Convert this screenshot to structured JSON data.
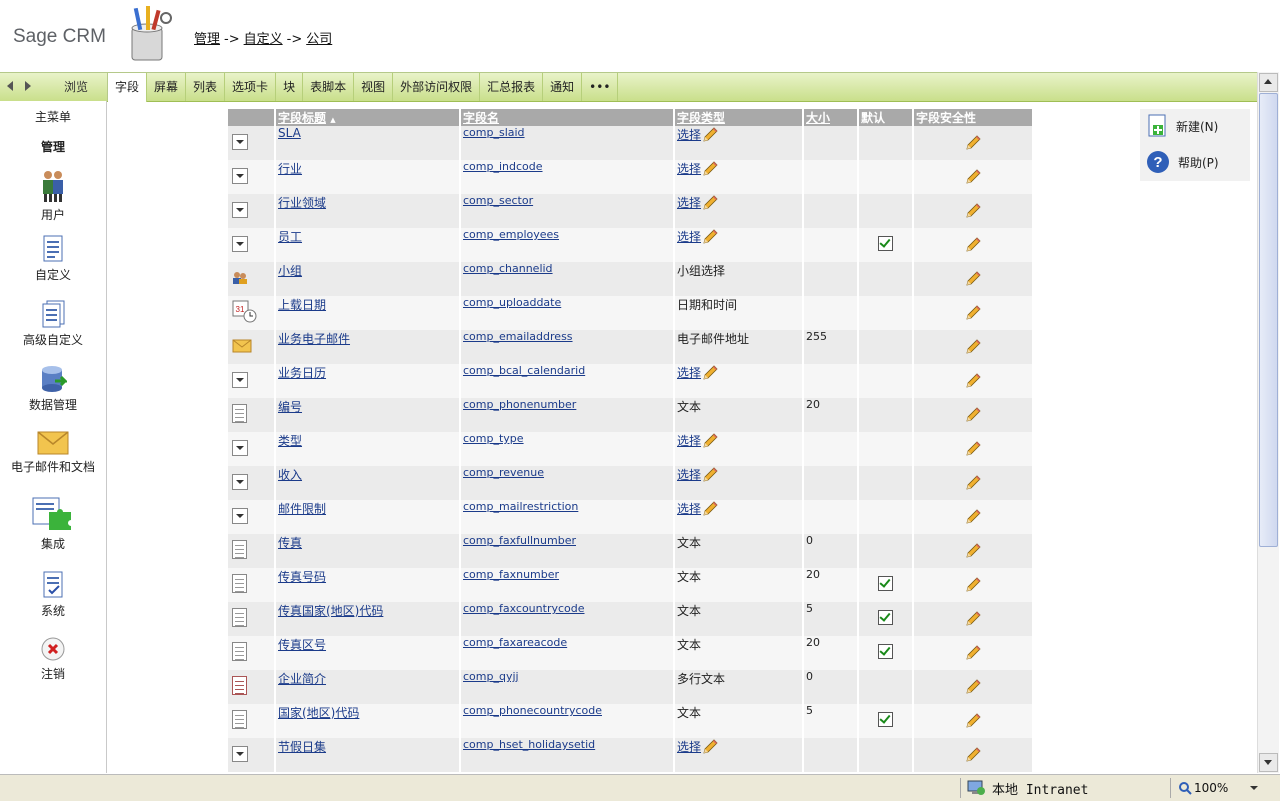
{
  "header": {
    "logo": "Sage CRM",
    "breadcrumb": [
      "管理",
      "自定义",
      "公司"
    ],
    "sep": "->"
  },
  "tabbar": {
    "browse": "浏览",
    "tabs": [
      "字段",
      "屏幕",
      "列表",
      "选项卡",
      "块",
      "表脚本",
      "视图",
      "外部访问权限",
      "汇总报表",
      "通知",
      "•••"
    ],
    "active": 0
  },
  "leftnav": {
    "main_menu": "主菜单",
    "admin": "管理",
    "items": [
      {
        "label": "用户",
        "icon": "users-icon"
      },
      {
        "label": "自定义",
        "icon": "document-icon"
      },
      {
        "label": "高级自定义",
        "icon": "documents-icon"
      },
      {
        "label": "数据管理",
        "icon": "database-icon"
      },
      {
        "label": "电子邮件和文档",
        "icon": "envelope-icon"
      },
      {
        "label": "集成",
        "icon": "puzzle-icon"
      },
      {
        "label": "系统",
        "icon": "checklist-icon"
      },
      {
        "label": "注销",
        "icon": "logout-icon"
      }
    ]
  },
  "actions": {
    "new": "新建(N)",
    "help": "帮助(P)"
  },
  "grid": {
    "columns": [
      "字段标题",
      "字段名",
      "字段类型",
      "大小",
      "默认",
      "字段安全性"
    ],
    "sort_indicator": "▲",
    "rows": [
      {
        "icon": "dropdown",
        "caption": "SLA",
        "name": "comp_slaid",
        "type": "选择",
        "type_link": true,
        "size": "",
        "default": false
      },
      {
        "icon": "dropdown",
        "caption": "行业",
        "name": "comp_indcode",
        "type": "选择",
        "type_link": true,
        "size": "",
        "default": false
      },
      {
        "icon": "dropdown",
        "caption": "行业领域",
        "name": "comp_sector",
        "type": "选择",
        "type_link": true,
        "size": "",
        "default": false
      },
      {
        "icon": "dropdown",
        "caption": "员工",
        "name": "comp_employees",
        "type": "选择",
        "type_link": true,
        "size": "",
        "default": true
      },
      {
        "icon": "team",
        "caption": "小组",
        "name": "comp_channelid",
        "type": "小组选择",
        "type_link": false,
        "size": "",
        "default": false
      },
      {
        "icon": "calendar",
        "caption": "上载日期",
        "name": "comp_uploaddate",
        "type": "日期和时间",
        "type_link": false,
        "size": "",
        "default": false
      },
      {
        "icon": "email",
        "caption": "业务电子邮件",
        "name": "comp_emailaddress",
        "type": "电子邮件地址",
        "type_link": false,
        "size": "255",
        "default": false
      },
      {
        "icon": "dropdown",
        "caption": "业务日历",
        "name": "comp_bcal_calendarid",
        "type": "选择",
        "type_link": true,
        "size": "",
        "default": false
      },
      {
        "icon": "text",
        "caption": "编号",
        "name": "comp_phonenumber",
        "type": "文本",
        "type_link": false,
        "size": "20",
        "default": false
      },
      {
        "icon": "dropdown",
        "caption": "类型",
        "name": "comp_type",
        "type": "选择",
        "type_link": true,
        "size": "",
        "default": false
      },
      {
        "icon": "dropdown",
        "caption": "收入",
        "name": "comp_revenue",
        "type": "选择",
        "type_link": true,
        "size": "",
        "default": false
      },
      {
        "icon": "dropdown",
        "caption": "邮件限制",
        "name": "comp_mailrestriction",
        "type": "选择",
        "type_link": true,
        "size": "",
        "default": false
      },
      {
        "icon": "text",
        "caption": "传真",
        "name": "comp_faxfullnumber",
        "type": "文本",
        "type_link": false,
        "size": "0",
        "default": false
      },
      {
        "icon": "text",
        "caption": "传真号码",
        "name": "comp_faxnumber",
        "type": "文本",
        "type_link": false,
        "size": "20",
        "default": true
      },
      {
        "icon": "text",
        "caption": "传真国家(地区)代码",
        "name": "comp_faxcountrycode",
        "type": "文本",
        "type_link": false,
        "size": "5",
        "default": true
      },
      {
        "icon": "text",
        "caption": "传真区号",
        "name": "comp_faxareacode",
        "type": "文本",
        "type_link": false,
        "size": "20",
        "default": true
      },
      {
        "icon": "memo",
        "caption": "企业简介",
        "name": "comp_qyjj",
        "type": "多行文本",
        "type_link": false,
        "size": "0",
        "default": false
      },
      {
        "icon": "text",
        "caption": "国家(地区)代码",
        "name": "comp_phonecountrycode",
        "type": "文本",
        "type_link": false,
        "size": "5",
        "default": true
      },
      {
        "icon": "dropdown",
        "caption": "节假日集",
        "name": "comp_hset_holidaysetid",
        "type": "选择",
        "type_link": true,
        "size": "",
        "default": false
      }
    ]
  },
  "statusbar": {
    "zone": "本地 Intranet",
    "zoom": "100%"
  },
  "colors": {
    "tabbar_top": "#e9f3c9",
    "tabbar_bottom": "#c9df8b",
    "grid_header": "#a9a9a9",
    "row_odd": "#ebebeb",
    "row_even": "#f6f6f6",
    "link": "#1b3b8a"
  }
}
